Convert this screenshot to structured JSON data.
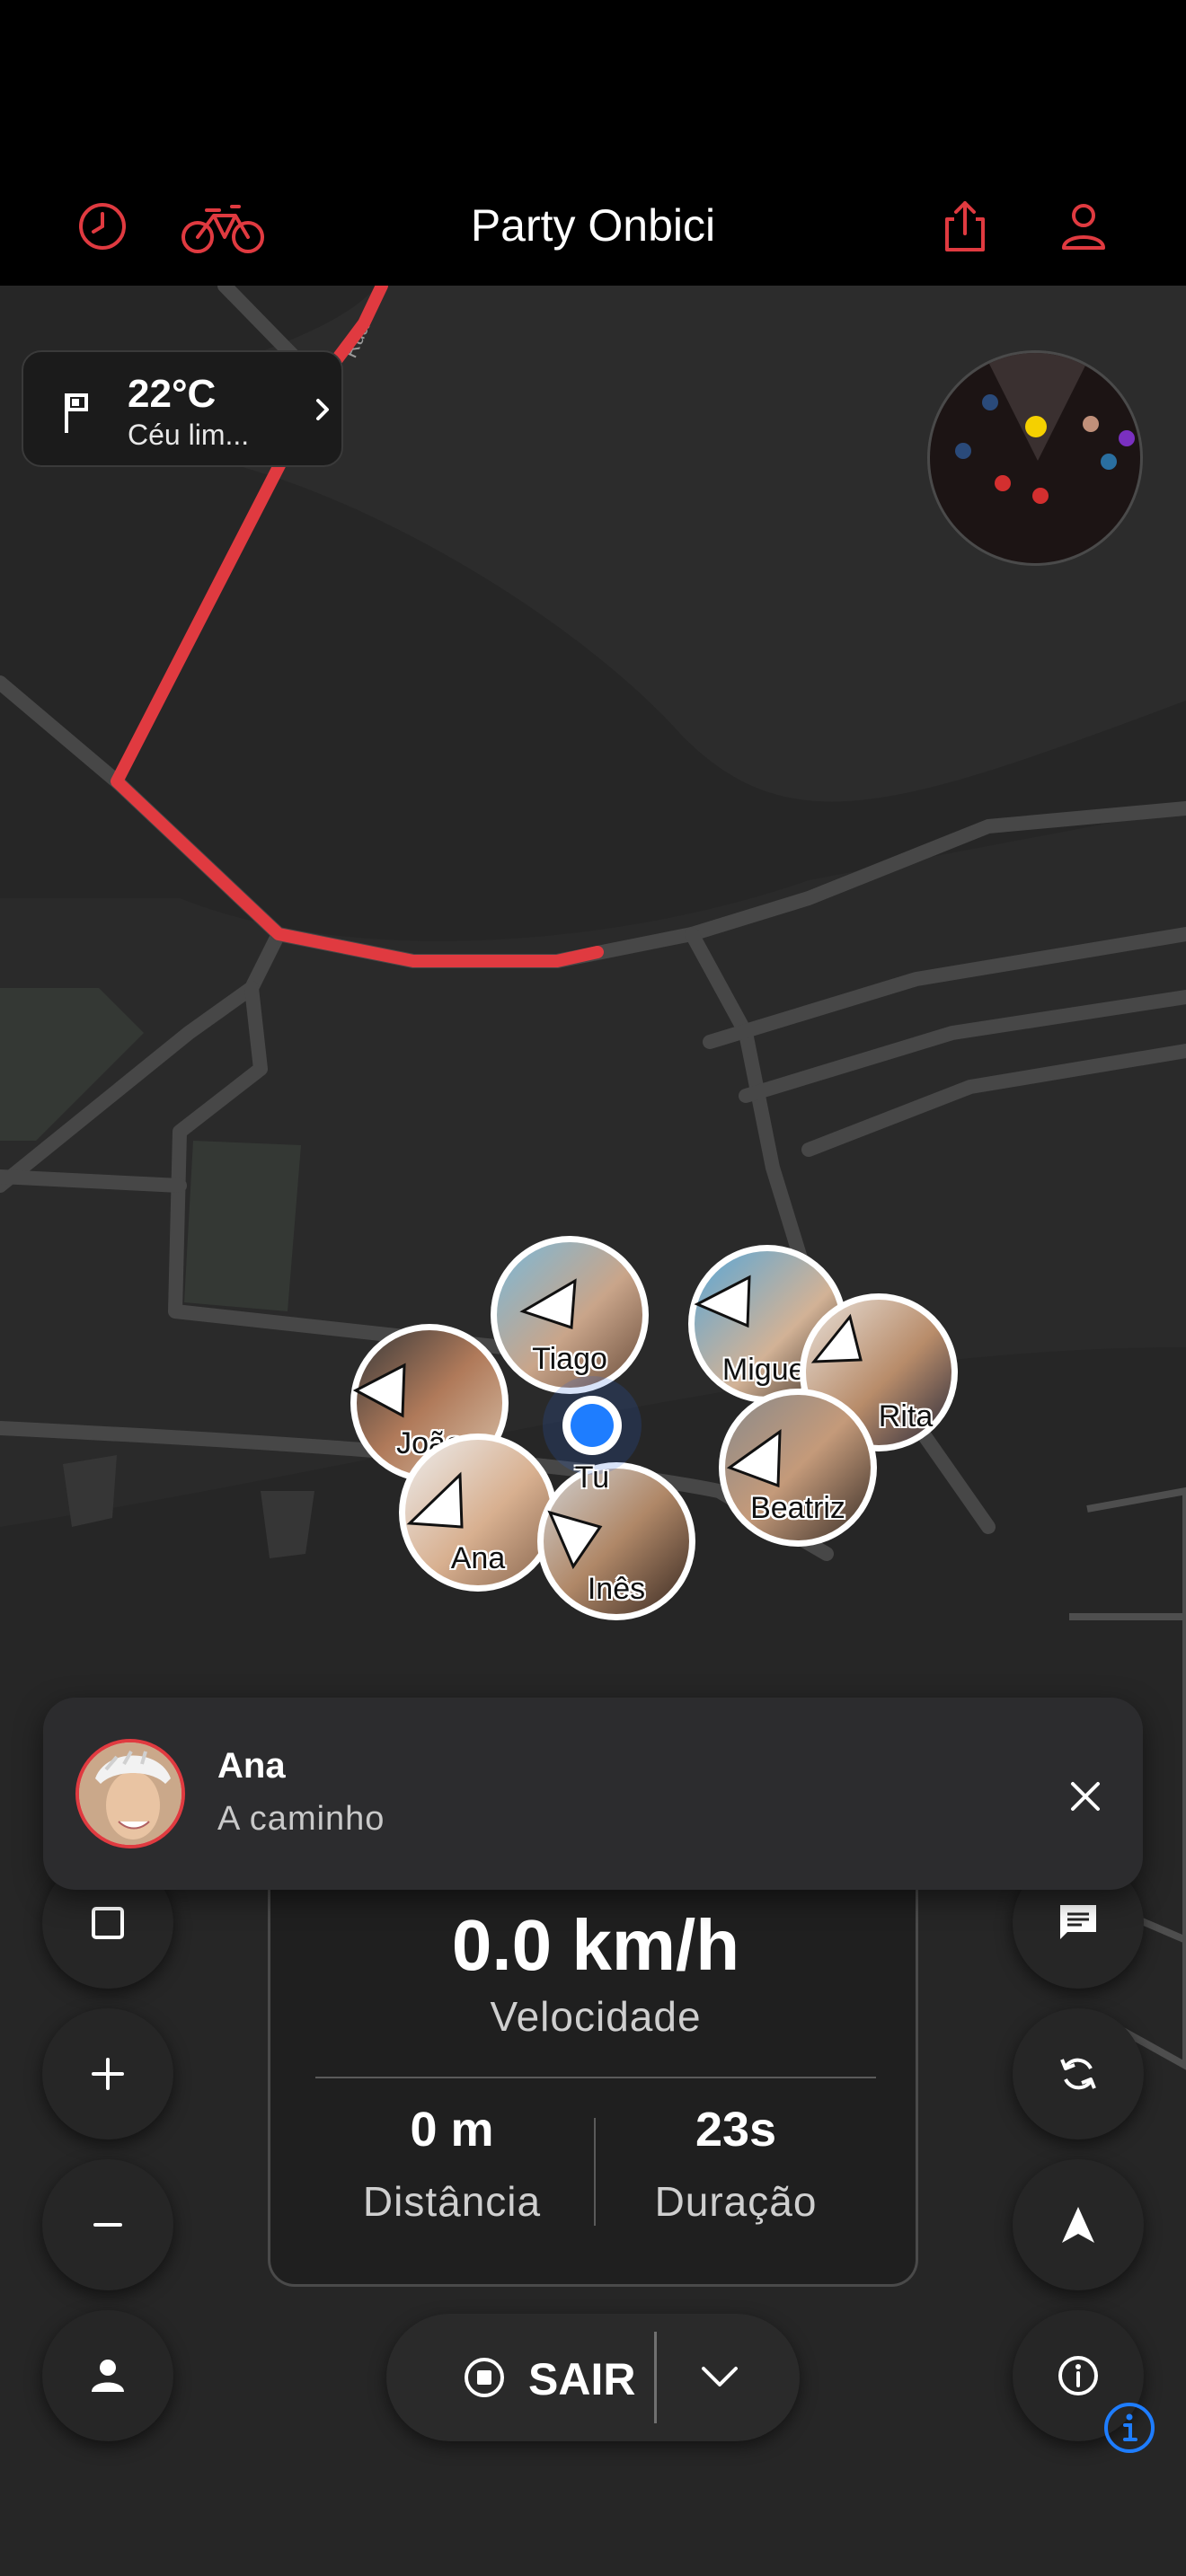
{
  "header": {
    "title": "Party Onbici",
    "colors": {
      "accent": "#e03a40",
      "background": "#000000"
    },
    "icons": [
      "history-icon",
      "bicycle-icon",
      "share-icon",
      "profile-icon"
    ]
  },
  "map": {
    "street_label": "Rua",
    "colors": {
      "route": "#e03a40",
      "road": "#4a4a4a",
      "land": "#262626"
    }
  },
  "weather": {
    "temperature": "22°C",
    "condition": "Céu lim..."
  },
  "markers": [
    {
      "name": "Tiago"
    },
    {
      "name": "Miguel"
    },
    {
      "name": "Rita"
    },
    {
      "name": "João"
    },
    {
      "name": "Beatriz"
    },
    {
      "name": "Ana"
    },
    {
      "name": "Inês"
    }
  ],
  "me_label": "Tu",
  "notification": {
    "name": "Ana",
    "status": "A caminho"
  },
  "stats": {
    "speed": "0.0 km/h",
    "speed_label": "Velocidade",
    "distance": "0 m",
    "distance_label": "Distância",
    "duration": "23s",
    "duration_label": "Duração"
  },
  "exit": {
    "label": "SAIR"
  },
  "left_controls": [
    "stop-square-icon",
    "zoom-in-icon",
    "zoom-out-icon",
    "person-icon"
  ],
  "right_controls": [
    "chat-icon",
    "sync-icon",
    "navigation-arrow-icon",
    "info-icon"
  ]
}
